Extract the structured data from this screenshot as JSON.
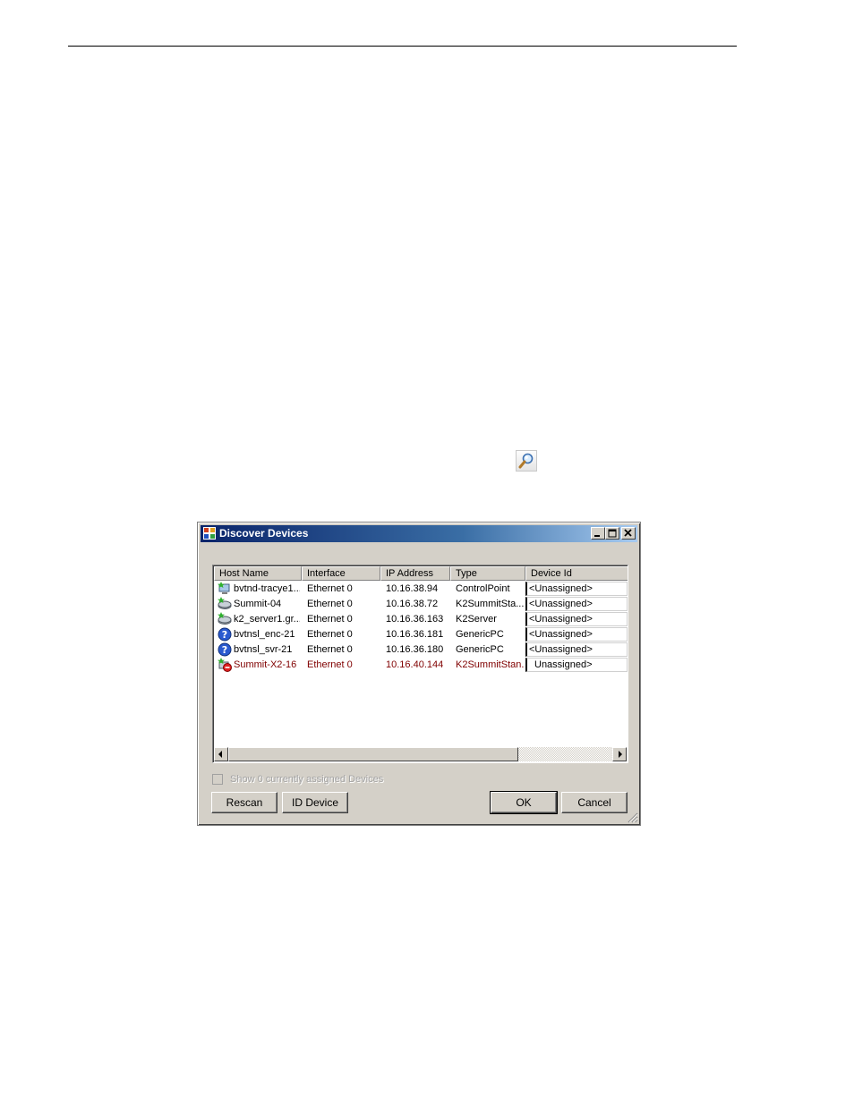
{
  "page": {
    "tool_icon": "magnifier-icon"
  },
  "window": {
    "title": "Discover Devices",
    "app_icon": "discover-devices-app-icon",
    "caption_buttons": [
      "minimize",
      "maximize",
      "close"
    ]
  },
  "columns": [
    "Host Name",
    "Interface",
    "IP Address",
    "Type",
    "Device Id"
  ],
  "devices": [
    {
      "icon": "controlpoint-pc-icon",
      "host": "bvtnd-tracye1...",
      "iface": "Ethernet 0",
      "ip": "10.16.38.94",
      "type": "ControlPoint",
      "device_id": "<Unassigned>"
    },
    {
      "icon": "k2-summit-icon",
      "host": "Summit-04",
      "iface": "Ethernet 0",
      "ip": "10.16.38.72",
      "type": "K2SummitSta...",
      "device_id": "<Unassigned>"
    },
    {
      "icon": "k2-server-icon",
      "host": "k2_server1.gr...",
      "iface": "Ethernet 0",
      "ip": "10.16.36.163",
      "type": "K2Server",
      "device_id": "<Unassigned>"
    },
    {
      "icon": "question-icon",
      "host": "bvtnsl_enc-21",
      "iface": "Ethernet 0",
      "ip": "10.16.36.181",
      "type": "GenericPC",
      "device_id": "<Unassigned>"
    },
    {
      "icon": "question-icon",
      "host": "bvtnsl_svr-21",
      "iface": "Ethernet 0",
      "ip": "10.16.36.180",
      "type": "GenericPC",
      "device_id": "<Unassigned>"
    },
    {
      "icon": "error-device-icon",
      "host": "Summit-X2-16",
      "iface": "Ethernet 0",
      "ip": "10.16.40.144",
      "type": "K2SummitStan...",
      "device_id": "Unassigned>"
    }
  ],
  "show_assigned_label": "Show 0 currently assigned Devices",
  "buttons": {
    "rescan": "Rescan",
    "id_device": "ID Device",
    "ok": "OK",
    "cancel": "Cancel"
  },
  "colors": {
    "title_start": "#0a246a",
    "title_end": "#a6caf0",
    "dialog_bg": "#d4d0c8",
    "error_row_text": "#800000"
  }
}
